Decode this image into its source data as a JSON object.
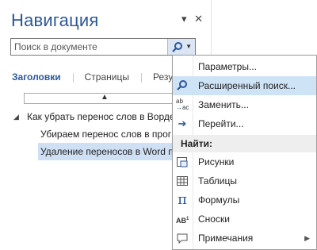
{
  "pane": {
    "title": "Навигация",
    "dropdown_glyph": "▾",
    "close_glyph": "✕",
    "search": {
      "placeholder": "Поиск в документе"
    },
    "tabs": [
      {
        "label": "Заголовки",
        "active": true
      },
      {
        "label": "Страницы",
        "active": false
      },
      {
        "label": "Резу",
        "active": false
      }
    ],
    "scroll_up_glyph": "▲",
    "tree": [
      {
        "label": "Как убрать перенос слов в Ворде",
        "expand": "◢"
      },
      {
        "label": "Убираем перенос слов в прог"
      },
      {
        "label": "Удаление переносов в Word п"
      }
    ]
  },
  "menu": {
    "items": [
      {
        "icon": "",
        "label": "Параметры..."
      },
      {
        "icon": "⚲",
        "label": "Расширенный поиск..."
      },
      {
        "icon": "ab→ac",
        "label": "Заменить..."
      },
      {
        "icon": "➔",
        "label": "Перейти..."
      }
    ],
    "header": "Найти:",
    "find_items": [
      {
        "icon": "▣",
        "label": "Рисунки"
      },
      {
        "icon": "▦",
        "label": "Таблицы"
      },
      {
        "icon": "π",
        "label": "Формулы"
      },
      {
        "icon": "AB¹",
        "label": "Сноски"
      },
      {
        "icon": "▭",
        "label": "Примечания",
        "submenu": "▶"
      }
    ]
  }
}
